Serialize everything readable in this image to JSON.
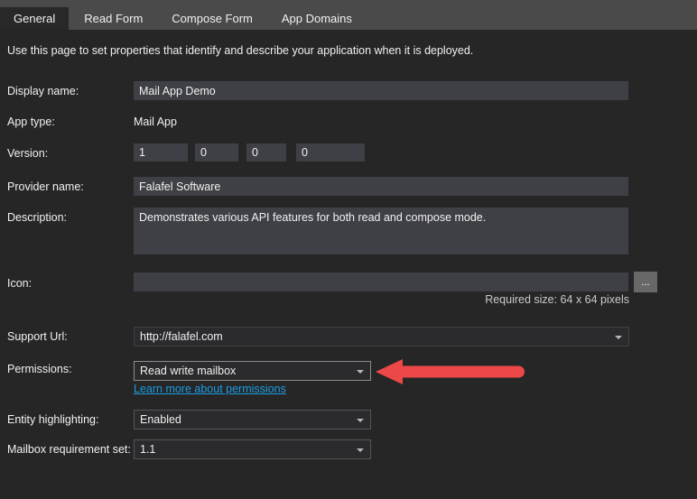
{
  "tabs": [
    {
      "label": "General",
      "active": true
    },
    {
      "label": "Read Form",
      "active": false
    },
    {
      "label": "Compose Form",
      "active": false
    },
    {
      "label": "App Domains",
      "active": false
    }
  ],
  "intro": "Use this page to set properties that identify and describe your application when it is deployed.",
  "fields": {
    "display_name": {
      "label": "Display name:",
      "value": "Mail App Demo"
    },
    "app_type": {
      "label": "App type:",
      "value": "Mail App"
    },
    "version": {
      "label": "Version:",
      "parts": [
        "1",
        "0",
        "0",
        "0"
      ]
    },
    "provider_name": {
      "label": "Provider name:",
      "value": "Falafel Software"
    },
    "description": {
      "label": "Description:",
      "value": "Demonstrates various API features for both read and compose mode."
    },
    "icon": {
      "label": "Icon:",
      "value": "",
      "browse_label": "...",
      "hint": "Required size: 64 x 64 pixels"
    },
    "support_url": {
      "label": "Support Url:",
      "value": "http://falafel.com"
    },
    "permissions": {
      "label": "Permissions:",
      "value": "Read write mailbox",
      "link": "Learn more about permissions"
    },
    "entity_highlighting": {
      "label": "Entity highlighting:",
      "value": "Enabled"
    },
    "mailbox_requirement_set": {
      "label": "Mailbox requirement set:",
      "value": "1.1"
    }
  },
  "colors": {
    "link_blue": "#1b9de2",
    "annotation_arrow_red": "#eb4847",
    "tabstrip_gray": "#4a4a4a",
    "page_background": "#262626",
    "input_background": "#3f4045"
  }
}
